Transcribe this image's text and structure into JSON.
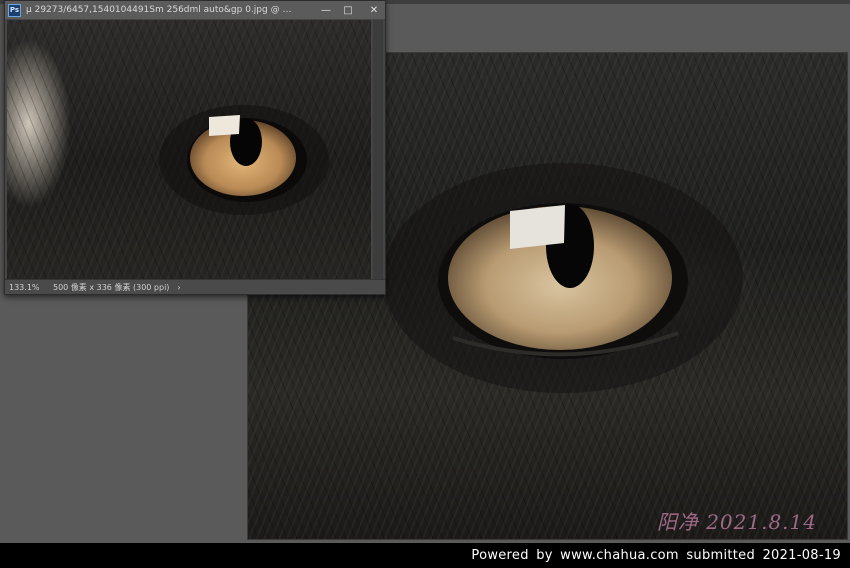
{
  "window": {
    "title": "µ   29273/6457,1540104491Sm   256dml   auto&gp   0.jpg @ 11.5...",
    "icon": "photoshop-doc-icon",
    "minimize_glyph": "—",
    "maximize_glyph": "□",
    "close_glyph": "✕"
  },
  "status": {
    "zoom": "133.1%",
    "doc_info": "500 像素 x 336 像素 (300 ppi)",
    "arrow": "›"
  },
  "canvas": {
    "signature": "阳净 2021.8.14"
  },
  "footer": {
    "credit": "Powered  by  www.chahua.com  submitted  2021-08-19"
  },
  "colors": {
    "workspace": "#5a5a5a",
    "iris": "#b89b72",
    "signature": "#9d6a86"
  }
}
